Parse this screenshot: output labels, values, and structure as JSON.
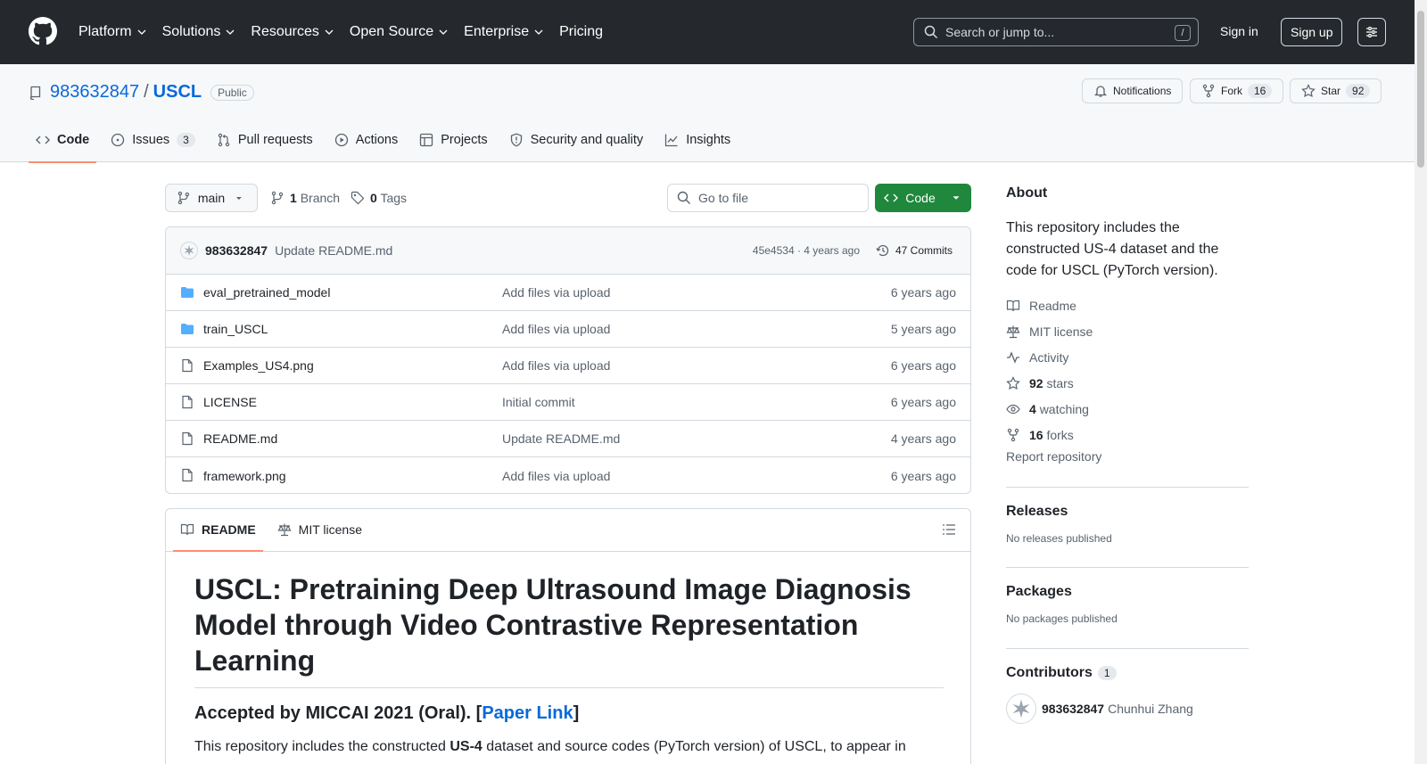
{
  "header": {
    "nav": [
      "Platform",
      "Solutions",
      "Resources",
      "Open Source",
      "Enterprise",
      "Pricing"
    ],
    "search_placeholder": "Search or jump to...",
    "search_shortcut": "/",
    "signin": "Sign in",
    "signup": "Sign up"
  },
  "repo": {
    "owner": "983632847",
    "separator": "/",
    "name": "USCL",
    "visibility": "Public",
    "notifications_label": "Notifications",
    "fork_label": "Fork",
    "fork_count": "16",
    "star_label": "Star",
    "star_count": "92"
  },
  "tabs": [
    {
      "label": "Code",
      "icon": "code-icon"
    },
    {
      "label": "Issues",
      "icon": "issue-icon",
      "count": "3"
    },
    {
      "label": "Pull requests",
      "icon": "pull-request-icon"
    },
    {
      "label": "Actions",
      "icon": "play-icon"
    },
    {
      "label": "Projects",
      "icon": "table-icon"
    },
    {
      "label": "Security and quality",
      "icon": "shield-icon"
    },
    {
      "label": "Insights",
      "icon": "graph-icon"
    }
  ],
  "toolbar": {
    "branch": "main",
    "branches_count": "1",
    "branches_label": "Branch",
    "tags_count": "0",
    "tags_label": "Tags",
    "goto_placeholder": "Go to file",
    "code_button": "Code"
  },
  "latest_commit": {
    "user": "983632847",
    "message": "Update README.md",
    "meta": "45e4534 · 4 years ago",
    "commits_label": "47 Commits"
  },
  "files": [
    {
      "type": "dir",
      "name": "eval_pretrained_model",
      "message": "Add files via upload",
      "age": "6 years ago"
    },
    {
      "type": "dir",
      "name": "train_USCL",
      "message": "Add files via upload",
      "age": "5 years ago"
    },
    {
      "type": "file",
      "name": "Examples_US4.png",
      "message": "Add files via upload",
      "age": "6 years ago"
    },
    {
      "type": "file",
      "name": "LICENSE",
      "message": "Initial commit",
      "age": "6 years ago"
    },
    {
      "type": "file",
      "name": "README.md",
      "message": "Update README.md",
      "age": "4 years ago"
    },
    {
      "type": "file",
      "name": "framework.png",
      "message": "Add files via upload",
      "age": "6 years ago"
    }
  ],
  "readme": {
    "tab_readme": "README",
    "tab_license": "MIT license",
    "h1": "USCL: Pretraining Deep Ultrasound Image Diagnosis Model through Video Contrastive Representation Learning",
    "h3_prefix": "Accepted by MICCAI 2021 (Oral). [",
    "h3_link": "Paper Link",
    "h3_suffix": "]",
    "p_prefix": "This repository includes the constructed ",
    "p_bold": "US-4",
    "p_suffix": " dataset and source codes (PyTorch version) of USCL, to appear in"
  },
  "sidebar": {
    "about_title": "About",
    "description": "This repository includes the constructed US-4 dataset and the code for USCL (PyTorch version).",
    "readme": "Readme",
    "license": "MIT license",
    "activity": "Activity",
    "stars_count": "92",
    "stars_label": "stars",
    "watching_count": "4",
    "watching_label": "watching",
    "forks_count": "16",
    "forks_label": "forks",
    "report": "Report repository",
    "releases_title": "Releases",
    "releases_sub": "No releases published",
    "packages_title": "Packages",
    "packages_sub": "No packages published",
    "contributors_title": "Contributors",
    "contributors_count": "1",
    "contributor_user": "983632847",
    "contributor_name": "Chunhui Zhang"
  },
  "colors": {
    "header_bg": "#25292e",
    "link": "#0969da",
    "green": "#1f883d",
    "tab_underline": "#fd8c73",
    "folder": "#54aeff"
  }
}
